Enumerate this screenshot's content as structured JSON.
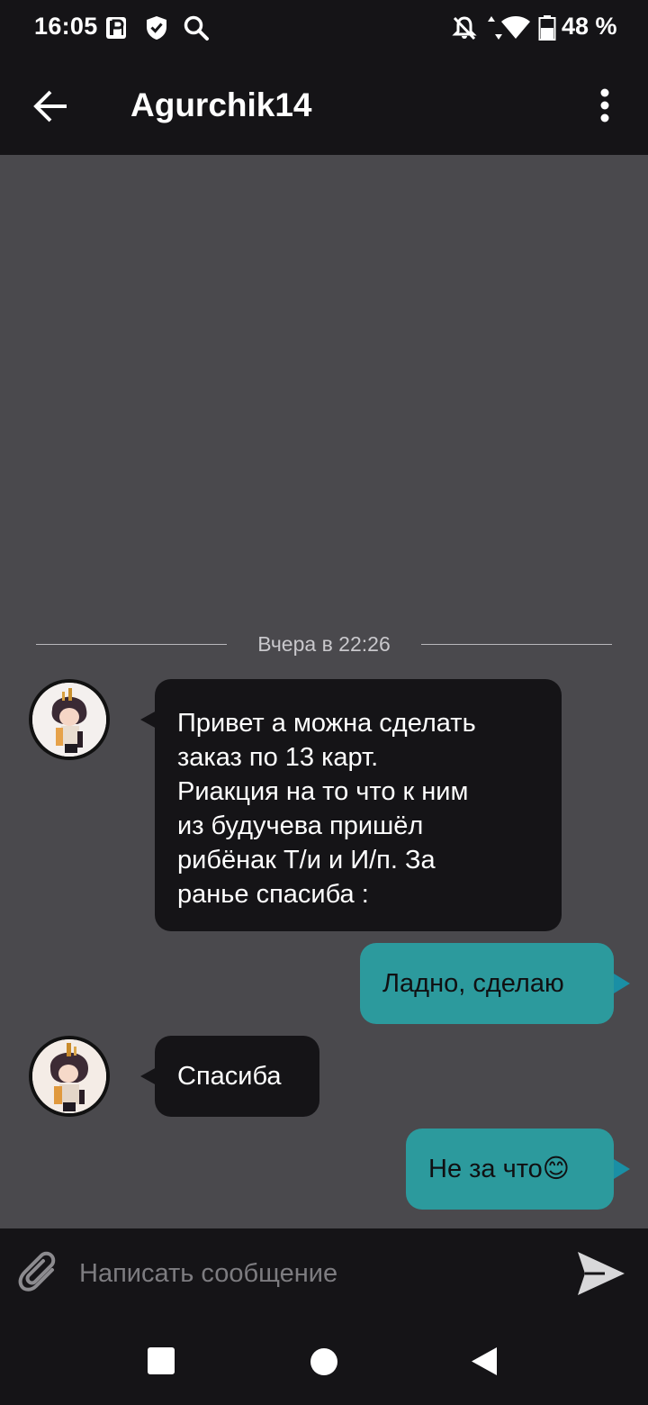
{
  "status_bar": {
    "time": "16:05",
    "battery": "48 %",
    "icons": [
      "parking-icon",
      "shield-icon",
      "search-icon",
      "notifications-off-icon",
      "data-arrows-icon",
      "wifi-icon",
      "battery-icon"
    ]
  },
  "header": {
    "title": "Agurchik14",
    "back_icon": "arrow-left-icon",
    "menu_icon": "more-vertical-icon"
  },
  "chat": {
    "date_separator": "Вчера в 22:26",
    "messages": [
      {
        "direction": "incoming",
        "lines": [
          "Привет а можна сделать",
          "заказ по 13 карт.",
          "Риакция на то что к ним",
          "из будучева пришёл",
          "рибёнак Т/и и И/п. За",
          "ранье спасиба :"
        ]
      },
      {
        "direction": "outgoing",
        "text": "Ладно, сделаю"
      },
      {
        "direction": "incoming",
        "text": "Спасиба"
      },
      {
        "direction": "outgoing",
        "text": "Не за что😊"
      }
    ]
  },
  "composer": {
    "placeholder": "Написать сообщение",
    "attach_icon": "paperclip-icon",
    "send_icon": "send-icon"
  },
  "nav_bar": {
    "icons": [
      "recents-square-icon",
      "home-circle-icon",
      "back-triangle-icon"
    ]
  },
  "colors": {
    "chrome_bg": "#151417",
    "chat_bg": "#4a494d",
    "incoming_bubble": "#151417",
    "outgoing_bubble": "#2c9a9d",
    "outgoing_tail": "#1a8fa5"
  }
}
